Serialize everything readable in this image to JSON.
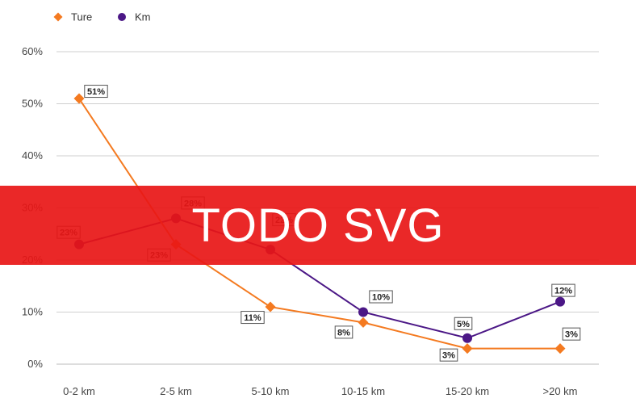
{
  "chart_data": {
    "type": "line",
    "categories": [
      "0-2 km",
      "2-5 km",
      "5-10 km",
      "10-15 km",
      "15-20 km",
      ">20 km"
    ],
    "series": [
      {
        "name": "Ture",
        "color": "#f47a20",
        "marker": "diamond",
        "values": [
          51,
          23,
          11,
          8,
          3,
          3
        ],
        "labels": [
          "51%",
          "23%",
          "11%",
          "8%",
          "3%",
          "3%"
        ]
      },
      {
        "name": "Km",
        "color": "#4b1786",
        "marker": "circle",
        "values": [
          23,
          28,
          22,
          10,
          5,
          12
        ],
        "labels": [
          "23%",
          "28%",
          "22%",
          "10%",
          "5%",
          "12%"
        ]
      }
    ],
    "y_ticks": [
      "0%",
      "10%",
      "20%",
      "30%",
      "40%",
      "50%",
      "60%"
    ],
    "ylim": [
      0,
      60
    ],
    "grid": true,
    "legend_position": "top-left"
  },
  "overlay": {
    "text": "TODO SVG",
    "color": "#e81616"
  }
}
